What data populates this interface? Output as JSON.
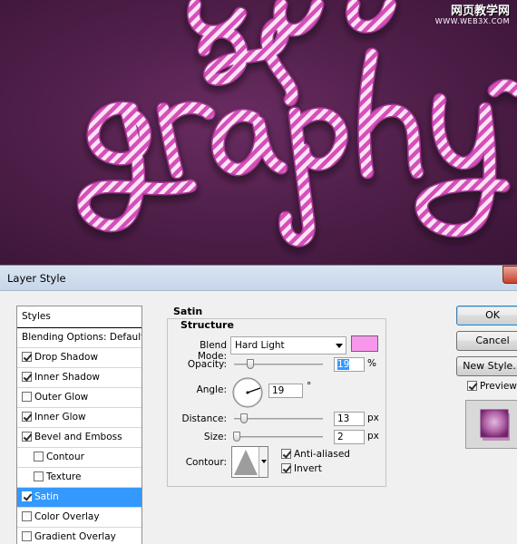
{
  "watermark": {
    "site_cn": "网页教学网",
    "url": "WWW.WEB3X.COM"
  },
  "dialog": {
    "title": "Layer Style",
    "style_list": [
      {
        "label": "Styles",
        "checkbox": false,
        "checked": false,
        "sub": false,
        "selected": false
      },
      {
        "label": "Blending Options: Default",
        "checkbox": false,
        "checked": false,
        "sub": false,
        "selected": false
      },
      {
        "label": "Drop Shadow",
        "checkbox": true,
        "checked": true,
        "sub": false,
        "selected": false
      },
      {
        "label": "Inner Shadow",
        "checkbox": true,
        "checked": true,
        "sub": false,
        "selected": false
      },
      {
        "label": "Outer Glow",
        "checkbox": true,
        "checked": false,
        "sub": false,
        "selected": false
      },
      {
        "label": "Inner Glow",
        "checkbox": true,
        "checked": true,
        "sub": false,
        "selected": false
      },
      {
        "label": "Bevel and Emboss",
        "checkbox": true,
        "checked": true,
        "sub": false,
        "selected": false
      },
      {
        "label": "Contour",
        "checkbox": true,
        "checked": false,
        "sub": true,
        "selected": false
      },
      {
        "label": "Texture",
        "checkbox": true,
        "checked": false,
        "sub": true,
        "selected": false
      },
      {
        "label": "Satin",
        "checkbox": true,
        "checked": true,
        "sub": false,
        "selected": true
      },
      {
        "label": "Color Overlay",
        "checkbox": true,
        "checked": false,
        "sub": false,
        "selected": false
      },
      {
        "label": "Gradient Overlay",
        "checkbox": true,
        "checked": false,
        "sub": false,
        "selected": false
      }
    ],
    "satin": {
      "title": "Satin",
      "structure_label": "Structure",
      "blend_mode_label": "Blend Mode:",
      "blend_mode_value": "Hard Light",
      "blend_color": "#f797eb",
      "opacity_label": "Opacity:",
      "opacity_value": "19",
      "opacity_unit": "%",
      "angle_label": "Angle:",
      "angle_value": "19",
      "angle_unit": "°",
      "distance_label": "Distance:",
      "distance_value": "13",
      "distance_unit": "px",
      "size_label": "Size:",
      "size_value": "2",
      "size_unit": "px",
      "contour_label": "Contour:",
      "anti_aliased_label": "Anti-aliased",
      "anti_aliased_checked": true,
      "invert_label": "Invert",
      "invert_checked": true
    },
    "buttons": {
      "ok": "OK",
      "cancel": "Cancel",
      "new_style": "New Style...",
      "preview_label": "Preview",
      "preview_checked": true
    }
  }
}
